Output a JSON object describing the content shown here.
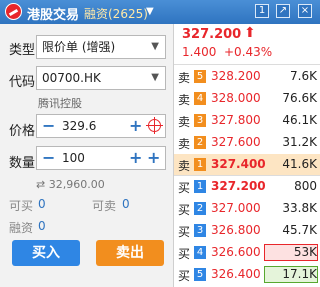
{
  "titlebar": {
    "title": "港股交易",
    "subtitle": "融资(2625)",
    "buttons": {
      "pin": "1",
      "popout": "↗",
      "close": "×"
    }
  },
  "form": {
    "type_label": "类型",
    "type_value": "限价单 (增强)",
    "code_label": "代码",
    "code_value": "00700.HK",
    "stock_name": "腾讯控股",
    "price_label": "价格",
    "price_value": "329.6",
    "qty_label": "数量",
    "qty_value": "100",
    "amount": "32,960.00",
    "buyable_label": "可买",
    "buyable_value": "0",
    "sellable_label": "可卖",
    "sellable_value": "0",
    "margin_label": "融资",
    "margin_value": "0",
    "buy_button": "买入",
    "sell_button": "卖出"
  },
  "quote": {
    "last_price": "327.200",
    "change": "1.400",
    "change_pct": "+0.43%"
  },
  "orderbook": {
    "asks": [
      {
        "side": "卖",
        "level": "5",
        "price": "328.200",
        "volume": "7.6K"
      },
      {
        "side": "卖",
        "level": "4",
        "price": "328.000",
        "volume": "76.6K"
      },
      {
        "side": "卖",
        "level": "3",
        "price": "327.800",
        "volume": "46.1K"
      },
      {
        "side": "卖",
        "level": "2",
        "price": "327.600",
        "volume": "31.2K"
      },
      {
        "side": "卖",
        "level": "1",
        "price": "327.400",
        "volume": "41.6K"
      }
    ],
    "bids": [
      {
        "side": "买",
        "level": "1",
        "price": "327.200",
        "volume": "800"
      },
      {
        "side": "买",
        "level": "2",
        "price": "327.000",
        "volume": "33.8K"
      },
      {
        "side": "买",
        "level": "3",
        "price": "326.800",
        "volume": "45.7K"
      },
      {
        "side": "买",
        "level": "4",
        "price": "326.600",
        "volume": "53K"
      },
      {
        "side": "买",
        "level": "5",
        "price": "326.400",
        "volume": "17.1K"
      }
    ]
  },
  "colors": {
    "up": "#e8262b",
    "buy": "#2f86e4",
    "sell": "#f28e1e",
    "titlebar": "#2f74c0"
  }
}
